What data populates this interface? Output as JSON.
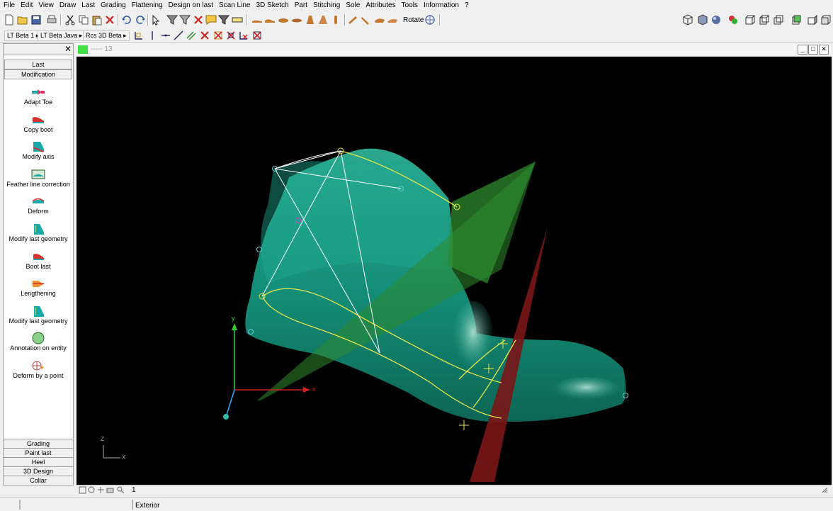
{
  "menubar": {
    "items": [
      "File",
      "Edit",
      "View",
      "Draw",
      "Last",
      "Grading",
      "Flattening",
      "Design on last",
      "Scan Line",
      "3D Sketch",
      "Part",
      "Stitching",
      "Sole",
      "Attributes",
      "Tools",
      "Information",
      "?"
    ]
  },
  "toolbar": {
    "rotate_label": "Rotate",
    "subtools": [
      "LT Beta 1",
      "LT Beta Java",
      "Rcs 3D Beta"
    ]
  },
  "sidepanel": {
    "category_top": [
      "Last",
      "Modification"
    ],
    "tools": [
      {
        "label": "Adapt Toe",
        "icon": "adapt-toe-icon"
      },
      {
        "label": "Copy boot",
        "icon": "copy-boot-icon"
      },
      {
        "label": "Modify axis",
        "icon": "modify-axis-icon"
      },
      {
        "label": "Feather line correction",
        "icon": "feather-line-icon"
      },
      {
        "label": "Deform",
        "icon": "deform-icon"
      },
      {
        "label": "Modify last geometry",
        "icon": "modify-geometry-icon"
      },
      {
        "label": "Boot last",
        "icon": "boot-last-icon"
      },
      {
        "label": "Lengthening",
        "icon": "lengthening-icon"
      },
      {
        "label": "Modify last geometry",
        "icon": "modify-geometry-icon"
      },
      {
        "label": "Annotation on entity",
        "icon": "annotation-icon"
      },
      {
        "label": "Deform by a point",
        "icon": "deform-point-icon"
      }
    ],
    "category_bottom": [
      "Grading",
      "Paint last",
      "Heel",
      "3D Design",
      "Collar"
    ]
  },
  "viewport": {
    "title": "----- 13",
    "colors": {
      "last": "#1a9d86",
      "plane_green": "#2e8b2e",
      "plane_red": "#7a1616",
      "curve": "#e6e64a",
      "axis_x": "#cc2222",
      "axis_y": "#33cc33",
      "axis_z": "#33aaff"
    },
    "axis_labels": {
      "x": "x",
      "y": "y",
      "mini_x": "X",
      "mini_z": "Z"
    }
  },
  "statusbar": {
    "page_num": "1",
    "mode": "Exterior"
  }
}
